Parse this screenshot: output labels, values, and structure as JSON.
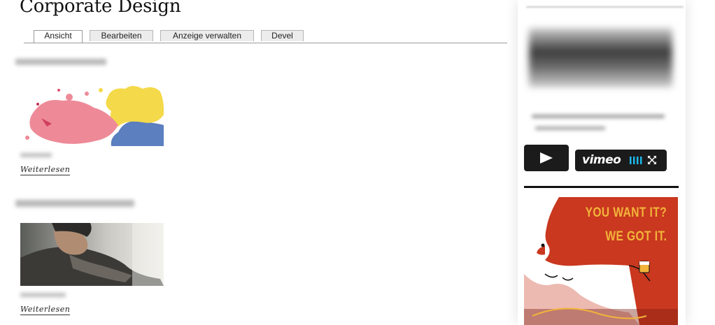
{
  "page": {
    "title": "Corporate Design"
  },
  "tabs": [
    {
      "label": "Ansicht",
      "active": true
    },
    {
      "label": "Bearbeiten",
      "active": false
    },
    {
      "label": "Anzeige verwalten",
      "active": false
    },
    {
      "label": "Devel",
      "active": false
    }
  ],
  "teasers": [
    {
      "image": "paint-splash-image",
      "read_more": "Weiterlesen"
    },
    {
      "image": "man-portrait-image",
      "read_more": "Weiterlesen"
    }
  ],
  "sidebar": {
    "video": {
      "play_icon": "play-icon",
      "logo": "vimeo",
      "controls": [
        "volume-bars-icon",
        "fullscreen-icon"
      ]
    },
    "ad": {
      "line1": "YOU WANT IT?",
      "line2": "WE GOT IT."
    }
  },
  "colors": {
    "ad_background": "#c9381f",
    "ad_text": "#f2b43a",
    "vimeo_blue": "#1ab7ea"
  }
}
